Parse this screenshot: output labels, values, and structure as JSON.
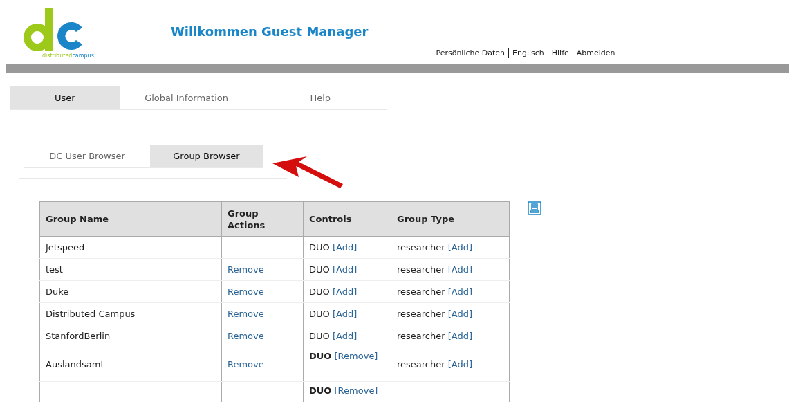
{
  "logo": {
    "first": "distributed",
    "second": "campus"
  },
  "title": "Willkommen Guest Manager",
  "top_links": [
    "Persönliche Daten",
    "Englisch",
    "Hilfe",
    "Abmelden"
  ],
  "tabs": [
    {
      "label": "User",
      "selected": true
    },
    {
      "label": "Global Information",
      "selected": false
    },
    {
      "label": "Help",
      "selected": false
    }
  ],
  "sub_tabs": [
    {
      "label": "DC User Browser",
      "selected": false
    },
    {
      "label": "Group Browser",
      "selected": true
    }
  ],
  "table": {
    "columns": [
      "Group Name",
      "Group Actions",
      "Controls",
      "Group Type"
    ],
    "rows": [
      {
        "name": "Jetspeed",
        "action": "",
        "control": {
          "label": "DUO",
          "assigned": false,
          "link": "[Add]"
        },
        "type": {
          "label": "researcher",
          "link": "[Add]"
        }
      },
      {
        "name": "test",
        "action": "Remove",
        "control": {
          "label": "DUO",
          "assigned": false,
          "link": "[Add]"
        },
        "type": {
          "label": "researcher",
          "link": "[Add]"
        }
      },
      {
        "name": "Duke",
        "action": "Remove",
        "control": {
          "label": "DUO",
          "assigned": false,
          "link": "[Add]"
        },
        "type": {
          "label": "researcher",
          "link": "[Add]"
        }
      },
      {
        "name": "Distributed Campus",
        "action": "Remove",
        "control": {
          "label": "DUO",
          "assigned": false,
          "link": "[Add]"
        },
        "type": {
          "label": "researcher",
          "link": "[Add]"
        }
      },
      {
        "name": "StanfordBerlin",
        "action": "Remove",
        "control": {
          "label": "DUO",
          "assigned": false,
          "link": "[Add]"
        },
        "type": {
          "label": "researcher",
          "link": "[Add]"
        }
      },
      {
        "name": "Auslandsamt",
        "action": "Remove",
        "control": {
          "label": "DUO",
          "assigned": true,
          "link": "[Remove]"
        },
        "type": {
          "label": "researcher",
          "link": "[Add]"
        }
      },
      {
        "control": {
          "label": "DUO",
          "assigned": true,
          "link": "[Remove]"
        }
      }
    ]
  }
}
